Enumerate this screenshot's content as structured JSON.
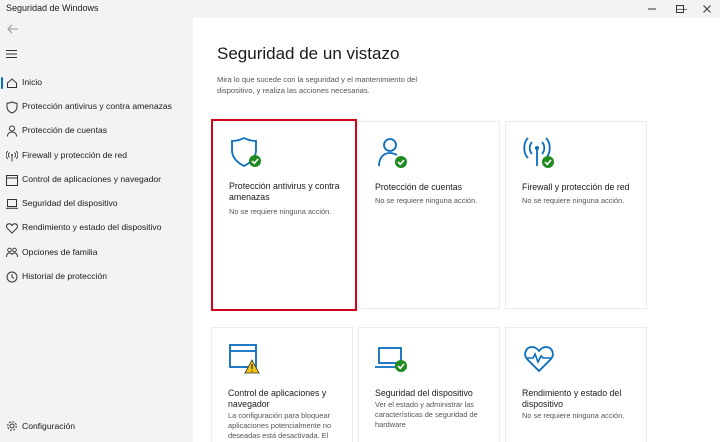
{
  "window": {
    "title": "Seguridad de Windows",
    "controls": {
      "minimize": "—",
      "maximize": "☐",
      "close": "✕"
    }
  },
  "colors": {
    "accent": "#0a6cbd",
    "ok": "#1f8a1f",
    "warn": "#f1c40f",
    "highlight": "#d0021b"
  },
  "sidebar": {
    "items": [
      {
        "label": "Inicio",
        "icon": "home-icon",
        "active": true
      },
      {
        "label": "Protección antivirus y contra amenazas",
        "icon": "shield-icon"
      },
      {
        "label": "Protección de cuentas",
        "icon": "person-icon"
      },
      {
        "label": "Firewall y protección de red",
        "icon": "wifi-antenna-icon"
      },
      {
        "label": "Control de aplicaciones y navegador",
        "icon": "app-browser-icon"
      },
      {
        "label": "Seguridad del dispositivo",
        "icon": "laptop-icon"
      },
      {
        "label": "Rendimiento y estado del dispositivo",
        "icon": "heart-icon"
      },
      {
        "label": "Opciones de familia",
        "icon": "family-icon"
      },
      {
        "label": "Historial de protección",
        "icon": "history-icon"
      }
    ],
    "settings": {
      "label": "Configuración",
      "icon": "gear-icon"
    }
  },
  "main": {
    "title": "Seguridad de un vistazo",
    "description": "Mira lo que sucede con la seguridad y el mantenimiento del dispositivo, y realiza las acciones necesarias.",
    "cards": [
      {
        "title": "Protección antivirus y contra amenazas",
        "status": "No se requiere ninguna acción.",
        "icon": "shield-check-icon"
      },
      {
        "title": "Protección de cuentas",
        "status": "No se requiere ninguna acción.",
        "icon": "person-check-icon"
      },
      {
        "title": "Firewall y protección de red",
        "status": "No se requiere ninguna acción.",
        "icon": "antenna-check-icon"
      },
      {
        "title": "Control de aplicaciones y navegador",
        "status": "La configuración para bloquear aplicaciones potencialmente no deseadas está desactivada. El",
        "icon": "browser-warning-icon"
      },
      {
        "title": "Seguridad del dispositivo",
        "status": "Ver el estado y administrar las características de seguridad de hardware",
        "icon": "laptop-check-icon"
      },
      {
        "title": "Rendimiento y estado del dispositivo",
        "status": "No se requiere ninguna acción.",
        "icon": "heart-pulse-icon"
      }
    ]
  }
}
